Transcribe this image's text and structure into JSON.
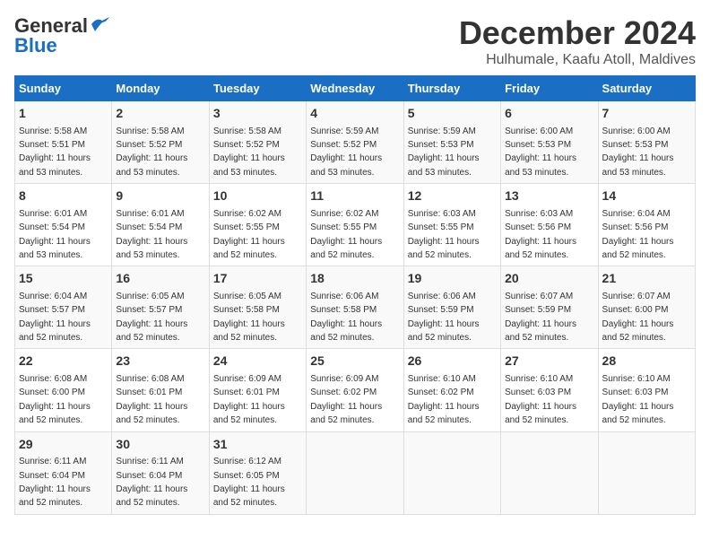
{
  "logo": {
    "line1": "General",
    "line2": "Blue"
  },
  "title": "December 2024",
  "subtitle": "Hulhumale, Kaafu Atoll, Maldives",
  "days_of_week": [
    "Sunday",
    "Monday",
    "Tuesday",
    "Wednesday",
    "Thursday",
    "Friday",
    "Saturday"
  ],
  "weeks": [
    [
      {
        "day": "1",
        "info": "Sunrise: 5:58 AM\nSunset: 5:51 PM\nDaylight: 11 hours\nand 53 minutes."
      },
      {
        "day": "2",
        "info": "Sunrise: 5:58 AM\nSunset: 5:52 PM\nDaylight: 11 hours\nand 53 minutes."
      },
      {
        "day": "3",
        "info": "Sunrise: 5:58 AM\nSunset: 5:52 PM\nDaylight: 11 hours\nand 53 minutes."
      },
      {
        "day": "4",
        "info": "Sunrise: 5:59 AM\nSunset: 5:52 PM\nDaylight: 11 hours\nand 53 minutes."
      },
      {
        "day": "5",
        "info": "Sunrise: 5:59 AM\nSunset: 5:53 PM\nDaylight: 11 hours\nand 53 minutes."
      },
      {
        "day": "6",
        "info": "Sunrise: 6:00 AM\nSunset: 5:53 PM\nDaylight: 11 hours\nand 53 minutes."
      },
      {
        "day": "7",
        "info": "Sunrise: 6:00 AM\nSunset: 5:53 PM\nDaylight: 11 hours\nand 53 minutes."
      }
    ],
    [
      {
        "day": "8",
        "info": "Sunrise: 6:01 AM\nSunset: 5:54 PM\nDaylight: 11 hours\nand 53 minutes."
      },
      {
        "day": "9",
        "info": "Sunrise: 6:01 AM\nSunset: 5:54 PM\nDaylight: 11 hours\nand 53 minutes."
      },
      {
        "day": "10",
        "info": "Sunrise: 6:02 AM\nSunset: 5:55 PM\nDaylight: 11 hours\nand 52 minutes."
      },
      {
        "day": "11",
        "info": "Sunrise: 6:02 AM\nSunset: 5:55 PM\nDaylight: 11 hours\nand 52 minutes."
      },
      {
        "day": "12",
        "info": "Sunrise: 6:03 AM\nSunset: 5:55 PM\nDaylight: 11 hours\nand 52 minutes."
      },
      {
        "day": "13",
        "info": "Sunrise: 6:03 AM\nSunset: 5:56 PM\nDaylight: 11 hours\nand 52 minutes."
      },
      {
        "day": "14",
        "info": "Sunrise: 6:04 AM\nSunset: 5:56 PM\nDaylight: 11 hours\nand 52 minutes."
      }
    ],
    [
      {
        "day": "15",
        "info": "Sunrise: 6:04 AM\nSunset: 5:57 PM\nDaylight: 11 hours\nand 52 minutes."
      },
      {
        "day": "16",
        "info": "Sunrise: 6:05 AM\nSunset: 5:57 PM\nDaylight: 11 hours\nand 52 minutes."
      },
      {
        "day": "17",
        "info": "Sunrise: 6:05 AM\nSunset: 5:58 PM\nDaylight: 11 hours\nand 52 minutes."
      },
      {
        "day": "18",
        "info": "Sunrise: 6:06 AM\nSunset: 5:58 PM\nDaylight: 11 hours\nand 52 minutes."
      },
      {
        "day": "19",
        "info": "Sunrise: 6:06 AM\nSunset: 5:59 PM\nDaylight: 11 hours\nand 52 minutes."
      },
      {
        "day": "20",
        "info": "Sunrise: 6:07 AM\nSunset: 5:59 PM\nDaylight: 11 hours\nand 52 minutes."
      },
      {
        "day": "21",
        "info": "Sunrise: 6:07 AM\nSunset: 6:00 PM\nDaylight: 11 hours\nand 52 minutes."
      }
    ],
    [
      {
        "day": "22",
        "info": "Sunrise: 6:08 AM\nSunset: 6:00 PM\nDaylight: 11 hours\nand 52 minutes."
      },
      {
        "day": "23",
        "info": "Sunrise: 6:08 AM\nSunset: 6:01 PM\nDaylight: 11 hours\nand 52 minutes."
      },
      {
        "day": "24",
        "info": "Sunrise: 6:09 AM\nSunset: 6:01 PM\nDaylight: 11 hours\nand 52 minutes."
      },
      {
        "day": "25",
        "info": "Sunrise: 6:09 AM\nSunset: 6:02 PM\nDaylight: 11 hours\nand 52 minutes."
      },
      {
        "day": "26",
        "info": "Sunrise: 6:10 AM\nSunset: 6:02 PM\nDaylight: 11 hours\nand 52 minutes."
      },
      {
        "day": "27",
        "info": "Sunrise: 6:10 AM\nSunset: 6:03 PM\nDaylight: 11 hours\nand 52 minutes."
      },
      {
        "day": "28",
        "info": "Sunrise: 6:10 AM\nSunset: 6:03 PM\nDaylight: 11 hours\nand 52 minutes."
      }
    ],
    [
      {
        "day": "29",
        "info": "Sunrise: 6:11 AM\nSunset: 6:04 PM\nDaylight: 11 hours\nand 52 minutes."
      },
      {
        "day": "30",
        "info": "Sunrise: 6:11 AM\nSunset: 6:04 PM\nDaylight: 11 hours\nand 52 minutes."
      },
      {
        "day": "31",
        "info": "Sunrise: 6:12 AM\nSunset: 6:05 PM\nDaylight: 11 hours\nand 52 minutes."
      },
      {
        "day": "",
        "info": ""
      },
      {
        "day": "",
        "info": ""
      },
      {
        "day": "",
        "info": ""
      },
      {
        "day": "",
        "info": ""
      }
    ]
  ]
}
